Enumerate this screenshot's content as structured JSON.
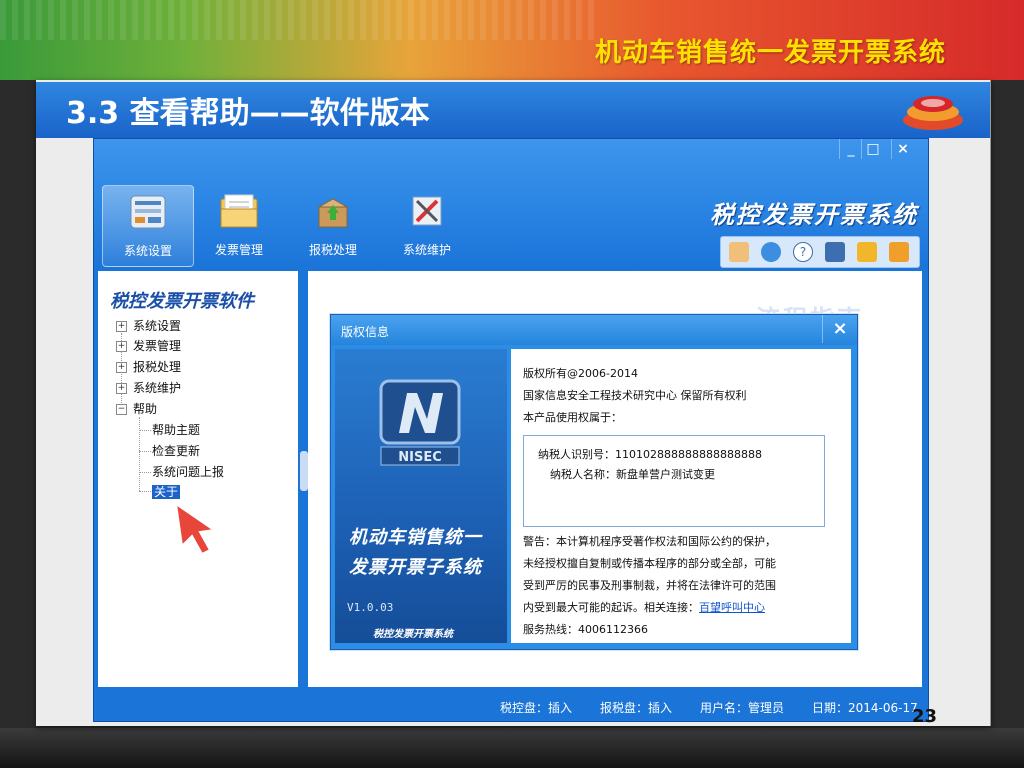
{
  "slide": {
    "header_title": "机动车销售统一发票开票系统",
    "section_title": "3.3  查看帮助——软件版本",
    "page_number": "23"
  },
  "window": {
    "controls": [
      "_",
      "□",
      "×"
    ],
    "brand_title": "税控发票开票系统",
    "toolbar": [
      {
        "label": "系统设置",
        "icon": "settings-icon"
      },
      {
        "label": "发票管理",
        "icon": "folder-icon"
      },
      {
        "label": "报税处理",
        "icon": "box-upload-icon"
      },
      {
        "label": "系统维护",
        "icon": "tools-icon"
      }
    ],
    "quick_icons": [
      "user-icon",
      "globe-icon",
      "help-icon",
      "window-icon",
      "key-icon",
      "lock-icon"
    ]
  },
  "tree": {
    "title": "税控发票开票软件",
    "nodes": [
      {
        "label": "系统设置",
        "toggle": "+"
      },
      {
        "label": "发票管理",
        "toggle": "+"
      },
      {
        "label": "报税处理",
        "toggle": "+"
      },
      {
        "label": "系统维护",
        "toggle": "+"
      },
      {
        "label": "帮助",
        "toggle": "−"
      }
    ],
    "help_children": [
      "帮助主题",
      "检查更新",
      "系统问题上报",
      "关于"
    ],
    "selected": "关于"
  },
  "content": {
    "watermark": "流程指南"
  },
  "dialog": {
    "title": "版权信息",
    "close": "×",
    "product_line1": "机动车销售统一",
    "product_line2": "发票开票子系统",
    "version": "V1.0.03",
    "brand": "税控发票开票系统",
    "logo_text": "NISEC",
    "copyright": "版权所有@2006-2014",
    "owner": "国家信息安全工程技术研究中心 保留所有权利",
    "license_to": "本产品使用权属于：",
    "taxpayer_id": "纳税人识别号：110102888888888888888",
    "taxpayer_name": "纳税人名称：新盘单营户测试变更",
    "warning_1": "警告：本计算机程序受著作权法和国际公约的保护，",
    "warning_2": "未经授权擅自复制或传播本程序的部分或全部，可能",
    "warning_3": "受到严厉的民事及刑事制裁，并将在法律许可的范围",
    "warning_4": "内受到最大可能的起诉。相关连接：",
    "hotline_link": "百望呼叫中心",
    "service_hotline": "服务热线：4006112366"
  },
  "status_bar": {
    "tax_disk": "税控盘：插入",
    "report_disk": "报税盘：插入",
    "user": "用户名：管理员",
    "date": "日期：2014-06-17"
  },
  "colors": {
    "header_yellow": "#ffe100",
    "app_blue": "#1b74d8",
    "title_blue": "#1a63c9",
    "link_blue": "#1155cc"
  }
}
